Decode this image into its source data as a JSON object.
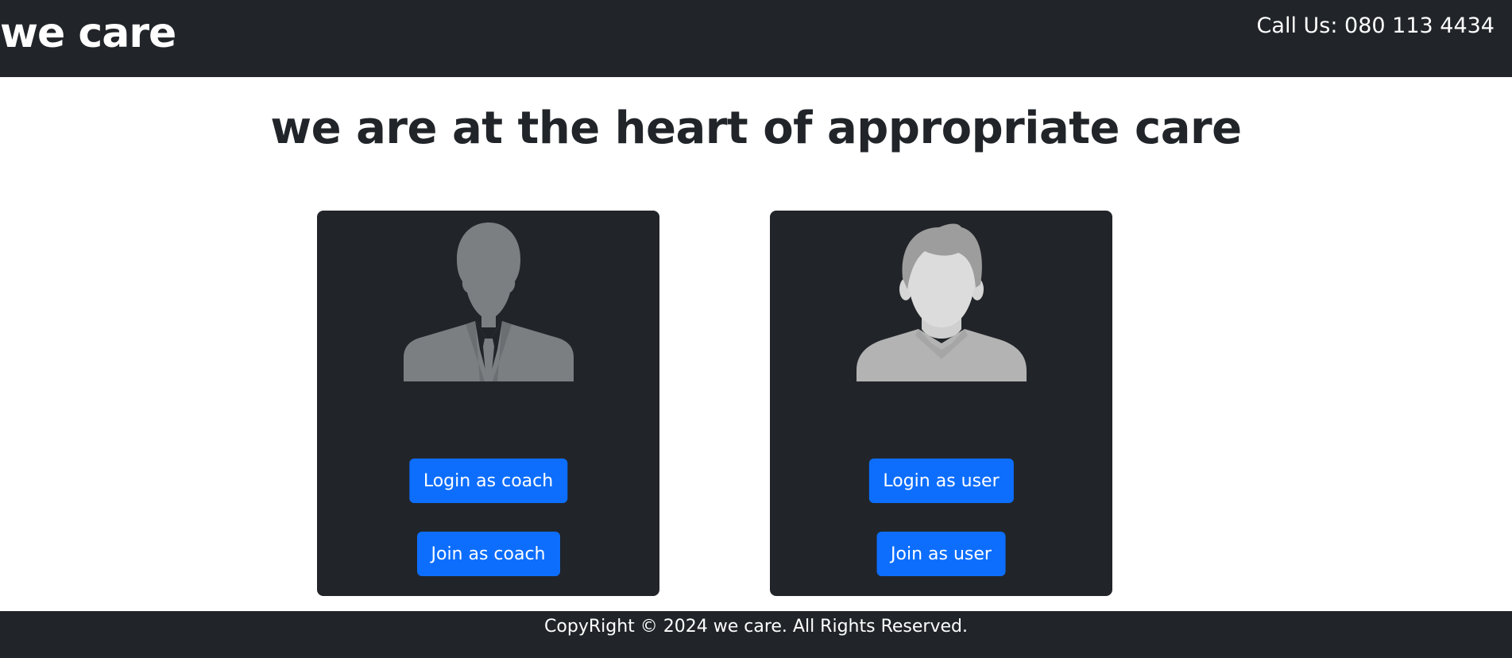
{
  "navbar": {
    "brand": "we care",
    "call": "Call Us: 080 113 4434"
  },
  "main": {
    "headline": "we are at the heart of appropriate care",
    "coach_card": {
      "avatar_icon": "businessman-silhouette-icon",
      "login_label": "Login as coach",
      "join_label": "Join as coach"
    },
    "user_card": {
      "avatar_icon": "user-avatar-icon",
      "login_label": "Login as user",
      "join_label": "Join as user"
    }
  },
  "footer": {
    "copyright": "CopyRight © 2024 we care. All Rights Reserved."
  },
  "colors": {
    "dark": "#212529",
    "primary": "#0d6efd",
    "white": "#ffffff",
    "coach_silhouette": "#7b7f82",
    "user_skin": "#dcdcdc",
    "user_hair": "#9d9d9d",
    "user_shirt": "#b3b3b3"
  }
}
